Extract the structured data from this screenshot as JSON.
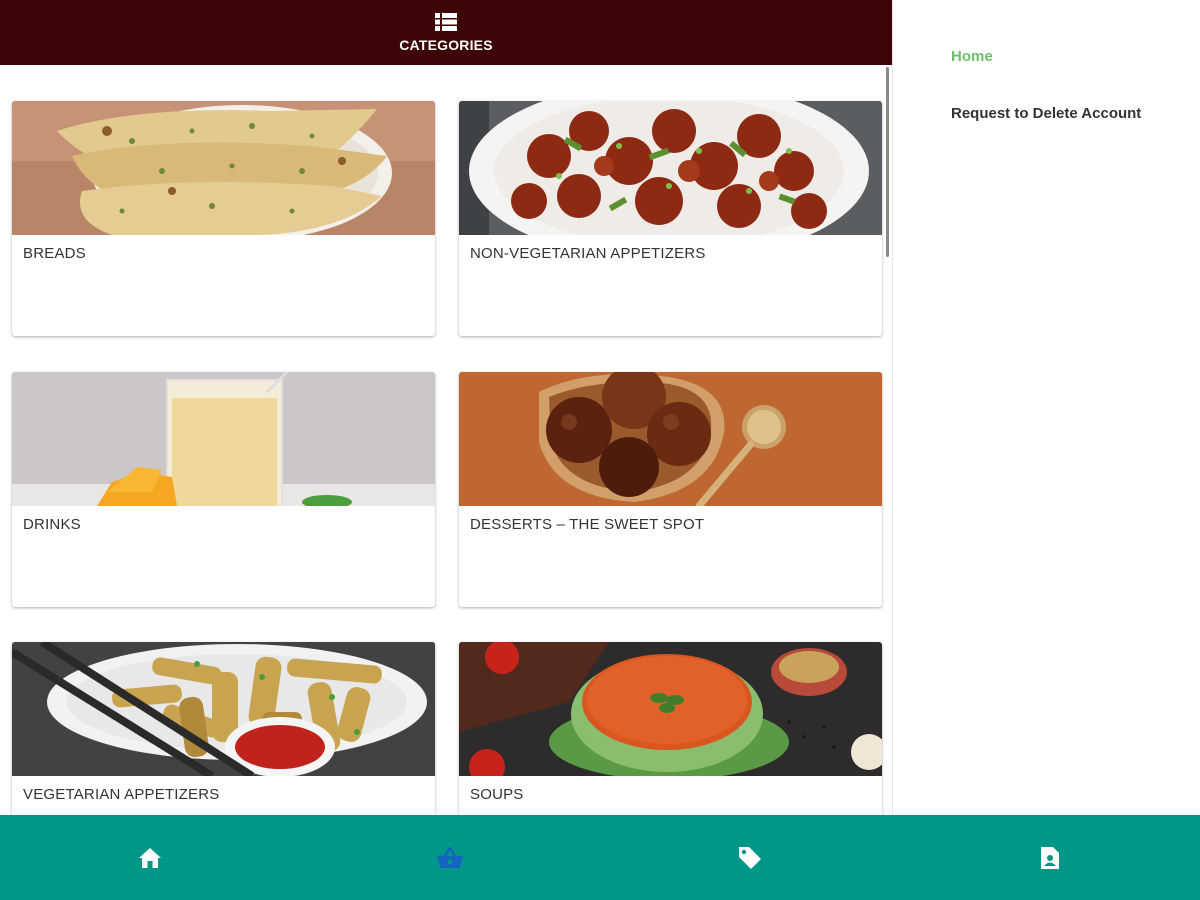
{
  "header": {
    "title": "CATEGORIES",
    "icon": "list-icon"
  },
  "categories": [
    {
      "label": "BREADS",
      "image": "garlic-naan-photo"
    },
    {
      "label": "NON-VEGETARIAN APPETIZERS",
      "image": "chilli-chicken-photo"
    },
    {
      "label": "DRINKS",
      "image": "mango-lassi-photo"
    },
    {
      "label": "DESSERTS – THE SWEET SPOT",
      "image": "gulab-jamun-photo"
    },
    {
      "label": "VEGETARIAN APPETIZERS",
      "image": "baby-corn-fry-photo"
    },
    {
      "label": "SOUPS",
      "image": "tomato-soup-photo"
    }
  ],
  "drawer": {
    "items": [
      {
        "label": "Home",
        "active": true
      },
      {
        "label": "Request to Delete Account",
        "active": false
      }
    ]
  },
  "bottom_nav": {
    "tabs": [
      {
        "icon": "home-icon",
        "active": false
      },
      {
        "icon": "basket-icon",
        "active": true
      },
      {
        "icon": "tag-icon",
        "active": false
      },
      {
        "icon": "document-icon",
        "active": false
      }
    ]
  },
  "colors": {
    "header_bg": "#3d0505",
    "bottom_nav_bg": "#009688",
    "drawer_active": "#6cbf6c",
    "nav_active_icon": "#1565c0"
  }
}
